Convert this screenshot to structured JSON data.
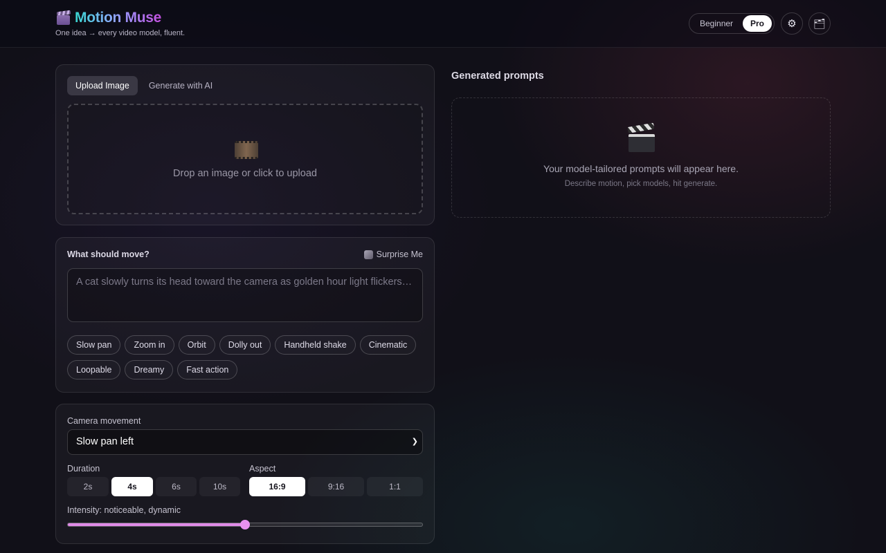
{
  "header": {
    "brand_name": "Motion Muse",
    "tagline": "One idea → every video model, fluent.",
    "mode_options": [
      "Beginner",
      "Pro"
    ],
    "mode_selected": "Pro",
    "settings_icon": "⚙",
    "folder_icon": "🗂"
  },
  "source": {
    "tabs": [
      "Upload Image",
      "Generate with AI"
    ],
    "active_tab": "Upload Image",
    "drop_text": "Drop an image or click to upload"
  },
  "motion": {
    "label": "What should move?",
    "surprise_label": "Surprise Me",
    "placeholder": "A cat slowly turns its head toward the camera as golden hour light flickers…",
    "chips": [
      "Slow pan",
      "Zoom in",
      "Orbit",
      "Dolly out",
      "Handheld shake",
      "Cinematic",
      "Loopable",
      "Dreamy",
      "Fast action"
    ]
  },
  "settings": {
    "camera_label": "Camera movement",
    "camera_value": "Slow pan left",
    "duration_label": "Duration",
    "durations": [
      "2s",
      "4s",
      "6s",
      "10s"
    ],
    "duration_selected": "4s",
    "aspect_label": "Aspect",
    "aspects": [
      "16:9",
      "9:16",
      "1:1"
    ],
    "aspect_selected": "16:9",
    "intensity_label": "Intensity: noticeable, dynamic",
    "intensity_fraction": 0.5
  },
  "output": {
    "title": "Generated prompts",
    "empty_main": "Your model-tailored prompts will appear here.",
    "empty_sub": "Describe motion, pick models, hit generate."
  },
  "colors": {
    "accent": "#e08be8",
    "background": "#111018"
  }
}
